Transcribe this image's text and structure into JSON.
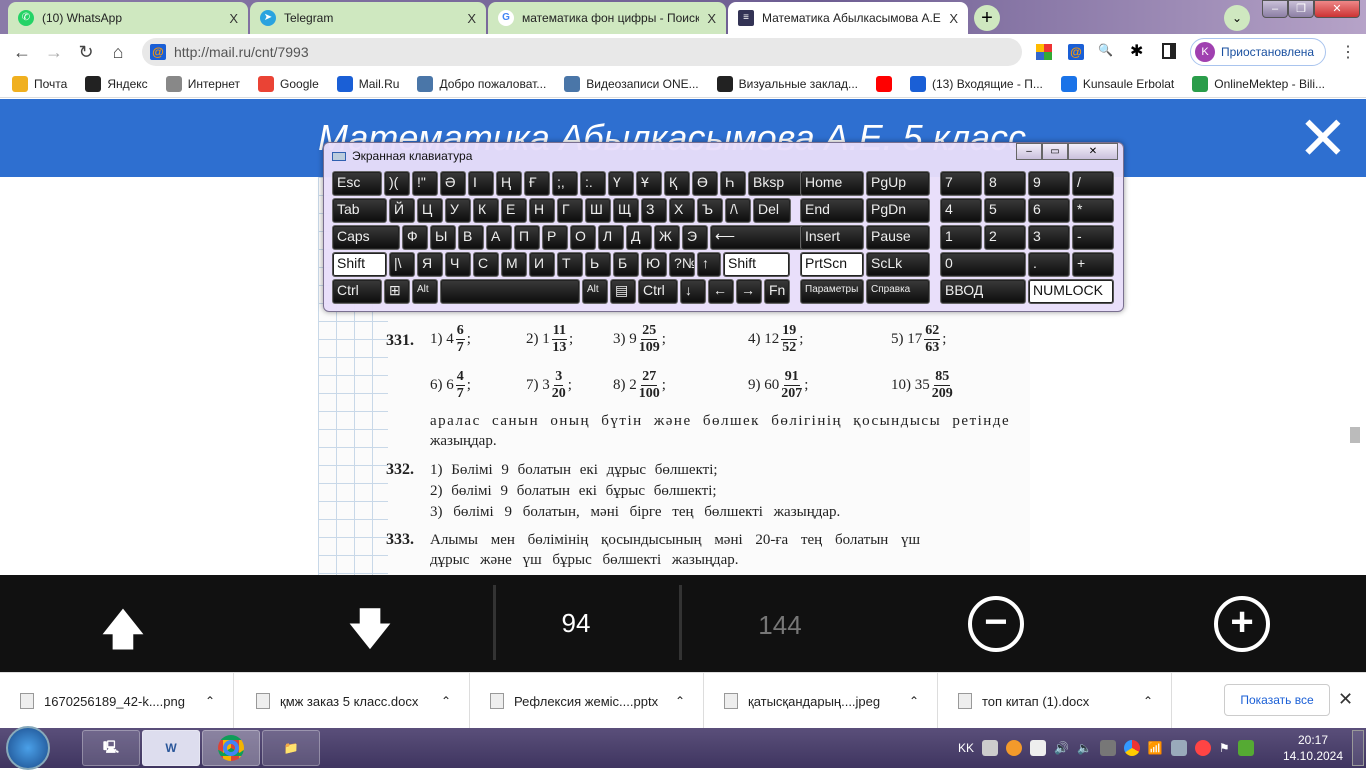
{
  "browser": {
    "tabs": [
      {
        "label": "(10) WhatsApp",
        "icon": "whatsapp-icon",
        "color": "#25d366"
      },
      {
        "label": "Telegram",
        "icon": "telegram-icon",
        "color": "#2aa3df"
      },
      {
        "label": "математика фон цифры - Поиск",
        "icon": "google-icon",
        "color": "#4285f4"
      },
      {
        "label": "Математика Абылкасымова А.Е.",
        "icon": "books-icon",
        "color": "#335"
      }
    ],
    "tab_close": "X",
    "new_tab": "+",
    "url": "http://mail.ru/cnt/7993",
    "profile_initial": "K",
    "profile_label": "Приостановлена",
    "bookmarks": [
      {
        "label": "Почта",
        "color": "#f0b020"
      },
      {
        "label": "Яндекс",
        "color": "#222"
      },
      {
        "label": "Интернет",
        "color": "#888"
      },
      {
        "label": "Google",
        "color": "#ea4335"
      },
      {
        "label": "Mail.Ru",
        "color": "#1a5fd6"
      },
      {
        "label": "Добро пожаловат...",
        "color": "#4a76a8"
      },
      {
        "label": "Видеозаписи ONE...",
        "color": "#4a76a8"
      },
      {
        "label": "Визуальные заклад...",
        "color": "#222"
      },
      {
        "label": "",
        "color": "#f00"
      },
      {
        "label": "(13) Входящие - П...",
        "color": "#1a5fd6"
      },
      {
        "label": "Kunsaule Erbolat",
        "color": "#1a73e8"
      },
      {
        "label": "OnlineMektep - Bili...",
        "color": "#2a9d4a"
      }
    ]
  },
  "viewer": {
    "title": "Математика Абылкасымова А.Е. 5 класс",
    "page_current": "94",
    "page_total": "144",
    "header_color": "#2e6fd0"
  },
  "book": {
    "ex331_num": "331.",
    "ex331_items": [
      {
        "n": "1)",
        "w": "4",
        "a": "6",
        "b": "7",
        "s": ";"
      },
      {
        "n": "2)",
        "w": "1",
        "a": "11",
        "b": "13",
        "s": ";"
      },
      {
        "n": "3)",
        "w": "9",
        "a": "25",
        "b": "109",
        "s": ";"
      },
      {
        "n": "4)",
        "w": "12",
        "a": "19",
        "b": "52",
        "s": ";"
      },
      {
        "n": "5)",
        "w": "17",
        "a": "62",
        "b": "63",
        "s": ";"
      },
      {
        "n": "6)",
        "w": "6",
        "a": "4",
        "b": "7",
        "s": ";"
      },
      {
        "n": "7)",
        "w": "3",
        "a": "3",
        "b": "20",
        "s": ";"
      },
      {
        "n": "8)",
        "w": "2",
        "a": "27",
        "b": "100",
        "s": ";"
      },
      {
        "n": "9)",
        "w": "60",
        "a": "91",
        "b": "207",
        "s": ";"
      },
      {
        "n": "10)",
        "w": "35",
        "a": "85",
        "b": "209",
        "s": ""
      }
    ],
    "ex331_text1": "аралас санын оның бүтін және бөлшек бөлігінің қосындысы ретінде",
    "ex331_text2": "жазыңдар.",
    "ex332_num": "332.",
    "ex332_lines": [
      "1) Бөлімі 9 болатын екі дұрыс бөлшекті;",
      "2) бөлімі 9 болатын екі бұрыс бөлшекті;",
      "3) бөлімі 9 болатын, мәні бірге тең бөлшекті жазыңдар."
    ],
    "ex333_num": "333.",
    "ex333_lines": [
      "Алымы мен бөлімінің қосындысының мәні 20-ға тең болатын үш",
      "дұрыс және үш бұрыс бөлшекті жазыңдар."
    ]
  },
  "osk": {
    "title": "Экранная клавиатура",
    "rows": [
      [
        "Esc",
        ")(",
        "!\"",
        "Ә",
        "І",
        "Ң",
        "Ғ",
        ";,",
        ":.",
        "Ү",
        "Ұ",
        "Қ",
        "Ө",
        "Һ",
        "Bksp"
      ],
      [
        "Tab",
        "Й",
        "Ц",
        "У",
        "К",
        "Е",
        "Н",
        "Г",
        "Ш",
        "Щ",
        "З",
        "Х",
        "Ъ",
        "/\\",
        "Del"
      ],
      [
        "Caps",
        "Ф",
        "Ы",
        "В",
        "А",
        "П",
        "Р",
        "О",
        "Л",
        "Д",
        "Ж",
        "Э",
        "⟵"
      ],
      [
        "Shift",
        "|\\",
        "Я",
        "Ч",
        "С",
        "М",
        "И",
        "Т",
        "Ь",
        "Б",
        "Ю",
        "?№",
        "↑",
        "Shift"
      ],
      [
        "Ctrl",
        "⊞",
        "Alt",
        "",
        "Alt",
        "▤",
        "Ctrl",
        "↓",
        "←",
        "→",
        "Fn"
      ]
    ],
    "nav_rows": [
      [
        "Home",
        "PgUp"
      ],
      [
        "End",
        "PgDn"
      ],
      [
        "Insert",
        "Pause"
      ],
      [
        "PrtScn",
        "ScLk"
      ],
      [
        "Параметры",
        "Справка"
      ]
    ],
    "num_rows": [
      [
        "7",
        "8",
        "9",
        "/"
      ],
      [
        "4",
        "5",
        "6",
        "*"
      ],
      [
        "1",
        "2",
        "3",
        "-"
      ],
      [
        "0",
        ".",
        "+"
      ],
      [
        "ВВОД",
        "NUMLOCK"
      ]
    ]
  },
  "downloads": {
    "items": [
      "1670256189_42-k....png",
      "қмж заказ 5 класс.docx",
      "Рефлексия жеміс....pptx",
      "қатысқандарың....jpeg",
      "топ китап (1).docx"
    ],
    "show_all": "Показать все"
  },
  "taskbar": {
    "lang": "KK",
    "time": "20:17",
    "date": "14.10.2024",
    "apps": [
      "computer-icon",
      "word-icon",
      "chrome-icon",
      "file-explorer-icon"
    ]
  }
}
